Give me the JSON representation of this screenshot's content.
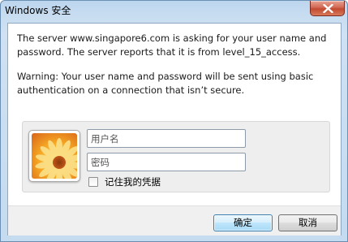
{
  "window": {
    "title": "Windows 安全"
  },
  "message": {
    "line1": "The server www.singapore6.com is asking for your user name and password. The server reports that it is from level_15_access.",
    "line2": "Warning: Your user name and password will be sent using basic authentication on a connection that isn’t secure."
  },
  "credentials": {
    "username_placeholder": "用户名",
    "password_placeholder": "密码",
    "remember_label": "记住我的凭据",
    "remember_checked": false,
    "avatar_icon": "user-tile-flower-icon"
  },
  "buttons": {
    "ok_label": "确定",
    "cancel_label": "取消"
  },
  "colors": {
    "frame": "#c4dbf0",
    "close_button": "#c24a30",
    "default_button_border": "#3c7fb1"
  }
}
